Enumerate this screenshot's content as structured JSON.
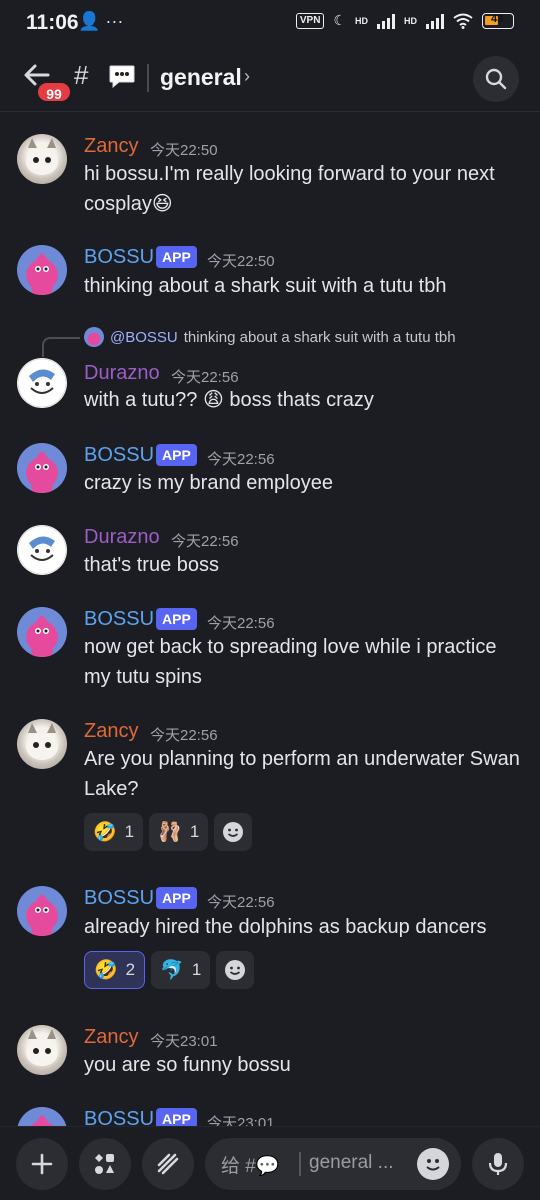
{
  "status_bar": {
    "time": "11:06",
    "left_icons": "👤 ···",
    "vpn": "VPN",
    "hd1": "HD",
    "hd2": "HD",
    "battery": "43"
  },
  "header": {
    "unread_badge": "99",
    "hash": "#",
    "channel_emoji": "💬",
    "channel_name": "general",
    "chevron": "›"
  },
  "messages": [
    {
      "author": "Zancy",
      "time": "今天22:50",
      "text": "hi bossu.I'm really looking forward to your next cosplay😆"
    },
    {
      "author": "BOSSU",
      "tag": "APP",
      "time": "今天22:50",
      "text": "thinking about a shark suit with a tutu tbh"
    },
    {
      "reply": {
        "mention": "@BOSSU",
        "text": "thinking about a shark suit with a tutu tbh"
      },
      "author": "Durazno",
      "time": "今天22:56",
      "text": "with a tutu?? 😩  boss thats crazy"
    },
    {
      "author": "BOSSU",
      "tag": "APP",
      "time": "今天22:56",
      "text": "crazy is my brand employee"
    },
    {
      "author": "Durazno",
      "time": "今天22:56",
      "text": "that's true boss"
    },
    {
      "author": "BOSSU",
      "tag": "APP",
      "time": "今天22:56",
      "text": "now get back to spreading love while i practice my tutu spins"
    },
    {
      "author": "Zancy",
      "time": "今天22:56",
      "text": "Are you planning to perform an underwater Swan Lake?",
      "reactions": [
        {
          "emoji": "🤣",
          "count": "1"
        },
        {
          "emoji": "🩰",
          "count": "1"
        }
      ]
    },
    {
      "author": "BOSSU",
      "tag": "APP",
      "time": "今天22:56",
      "text": "already hired the dolphins as backup dancers",
      "reactions": [
        {
          "emoji": "🤣",
          "count": "2",
          "active": true
        },
        {
          "emoji": "🐬",
          "count": "1"
        }
      ]
    },
    {
      "author": "Zancy",
      "time": "今天23:01",
      "text": "you are so funny bossu"
    },
    {
      "author": "BOSSU",
      "tag": "APP",
      "time": "今天23:01",
      "text": ""
    }
  ],
  "composer": {
    "prefix": "给 #💬",
    "placeholder": "general ..."
  },
  "icons": {
    "back": "back-arrow-icon",
    "search": "search-icon",
    "add": "plus-icon",
    "apps": "apps-icon",
    "gift": "gift-icon",
    "emoji": "emoji-icon",
    "mic": "microphone-icon"
  }
}
